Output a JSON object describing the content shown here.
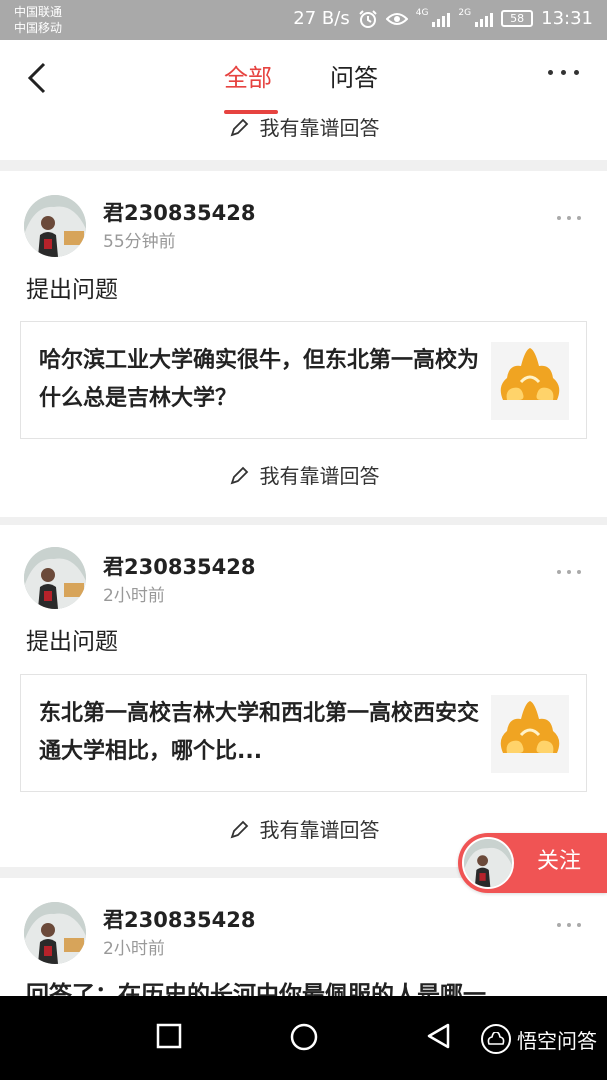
{
  "status_bar": {
    "carrier_1": "中国联通",
    "carrier_2": "中国移动",
    "net_speed": "27 B/s",
    "net_4g": "4G",
    "net_2g": "2G",
    "battery": "58",
    "time": "13:31"
  },
  "header": {
    "tabs": [
      {
        "label": "全部",
        "active": true
      },
      {
        "label": "问答",
        "active": false
      }
    ],
    "accent_color": "#e64340"
  },
  "feed": {
    "answer_label": "我有靠谱回答",
    "items": [
      {
        "username": "君230835428",
        "time": "55分钟前",
        "action": "提出问题",
        "question": "哈尔滨工业大学确实很牛，但东北第一高校为什么总是吉林大学？"
      },
      {
        "username": "君230835428",
        "time": "2小时前",
        "action": "提出问题",
        "question": "东北第一高校吉林大学和西北第一高校西安交通大学相比，哪个比..."
      },
      {
        "username": "君230835428",
        "time": "2小时前",
        "action": "回答了：在历史的长河中你最佩服的人是哪一"
      }
    ]
  },
  "follow_button": {
    "label": "关注",
    "color": "#f05454"
  },
  "watermark": {
    "text": "悟空问答"
  }
}
